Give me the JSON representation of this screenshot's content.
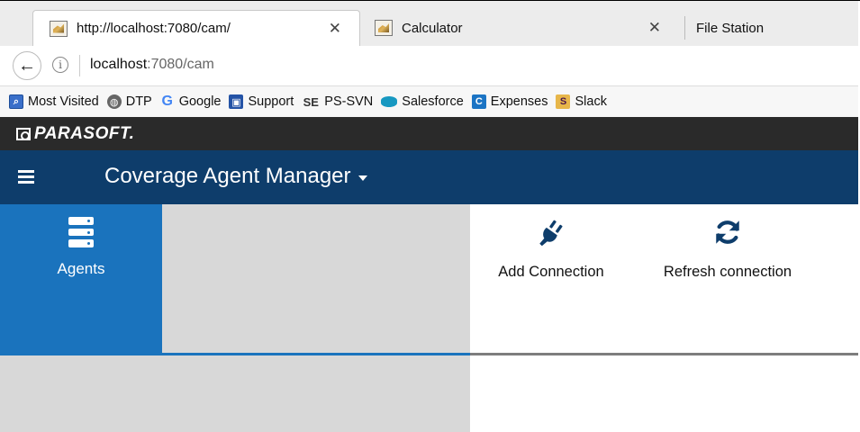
{
  "browser": {
    "tabs": [
      {
        "title": "http://localhost:7080/cam/",
        "active": true
      },
      {
        "title": "Calculator",
        "active": false
      },
      {
        "title": "File Station",
        "active": false
      }
    ],
    "close_glyph": "✕",
    "address": {
      "host": "localhost",
      "rest": ":7080/cam"
    },
    "bookmarks": [
      {
        "label": "Most Visited",
        "icon": "most-visited-icon"
      },
      {
        "label": "DTP",
        "icon": "globe-icon"
      },
      {
        "label": "Google",
        "icon": "google-icon"
      },
      {
        "label": "Support",
        "icon": "support-icon"
      },
      {
        "label": "PS-SVN",
        "icon": "se-icon"
      },
      {
        "label": "Salesforce",
        "icon": "salesforce-icon"
      },
      {
        "label": "Expenses",
        "icon": "expenses-icon"
      },
      {
        "label": "Slack",
        "icon": "slack-icon"
      }
    ]
  },
  "brand": {
    "name": "PARASOFT."
  },
  "app": {
    "title": "Coverage Agent Manager"
  },
  "nav": {
    "agents_label": "Agents"
  },
  "toolbar": {
    "add_connection": "Add Connection",
    "refresh_connection": "Refresh connection"
  },
  "colors": {
    "app_header": "#0e3d6b",
    "nav_active": "#1a73bd",
    "brand_bar": "#2a2a2a",
    "nav_bg": "#d8d8d8"
  }
}
